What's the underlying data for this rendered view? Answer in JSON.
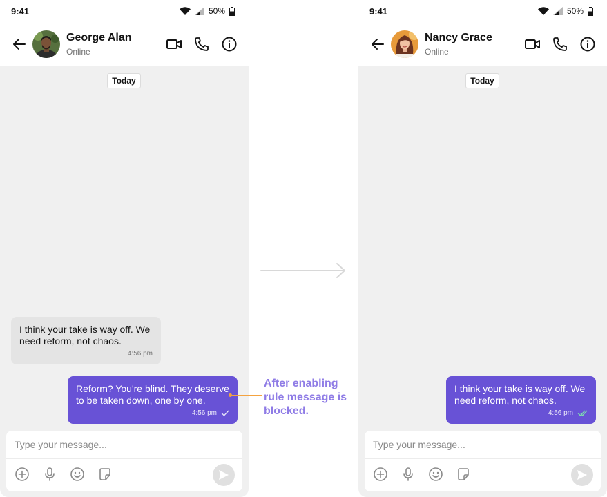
{
  "status_bar": {
    "time": "9:41",
    "battery": "50%"
  },
  "left_phone": {
    "contact": {
      "name": "George Alan",
      "status": "Online"
    },
    "date_chip": "Today",
    "messages": [
      {
        "direction": "incoming",
        "text": "I think your take is way off. We need reform, not chaos.",
        "time": "4:56 pm"
      },
      {
        "direction": "outgoing",
        "text": "Reform? You're blind. They deserve to be taken down, one by one.",
        "time": "4:56 pm",
        "receipt": "sent"
      }
    ],
    "composer": {
      "placeholder": "Type your message..."
    }
  },
  "right_phone": {
    "contact": {
      "name": "Nancy Grace",
      "status": "Online"
    },
    "date_chip": "Today",
    "messages": [
      {
        "direction": "outgoing",
        "text": "I think your take is way off. We need reform, not chaos.",
        "time": "4:56 pm",
        "receipt": "read"
      }
    ],
    "composer": {
      "placeholder": "Type your message..."
    }
  },
  "annotation": {
    "text": "After enabling rule message is blocked."
  },
  "icons": {
    "header": [
      "back-arrow-icon",
      "video-call-icon",
      "phone-icon",
      "info-icon"
    ],
    "composer": [
      "add-icon",
      "microphone-icon",
      "emoji-icon",
      "sticker-icon",
      "send-icon"
    ],
    "status": [
      "wifi-icon",
      "signal-icon",
      "battery-icon"
    ]
  },
  "colors": {
    "primary": "#6852d6",
    "incoming_bubble": "#e4e4e4",
    "chat_background": "#f0f0f0",
    "annotation_text": "#8f7ce6",
    "annotation_pointer": "#f4a340",
    "read_receipt": "#7ee0b0"
  }
}
